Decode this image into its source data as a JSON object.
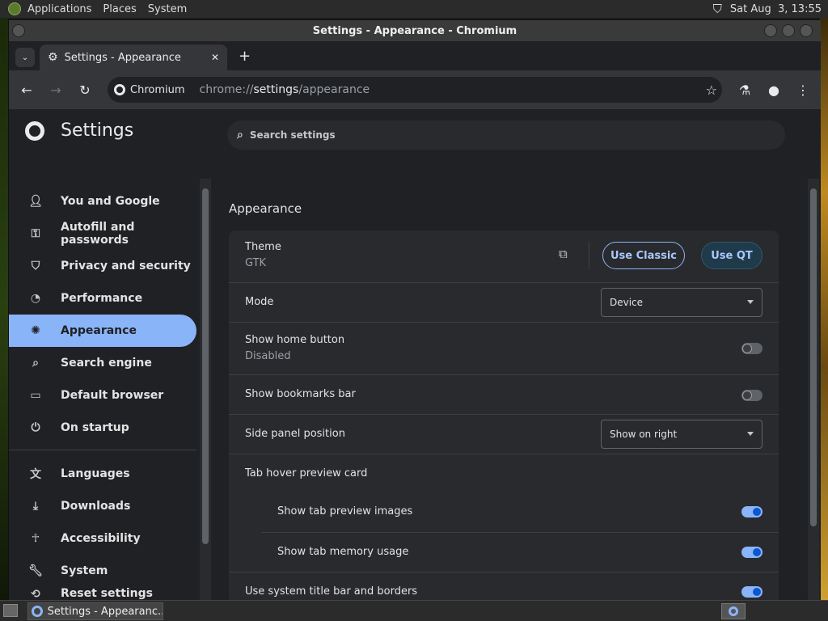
{
  "top_panel": {
    "menus": [
      "Applications",
      "Places",
      "System"
    ],
    "clock": "Sat Aug  3, 13:55"
  },
  "window": {
    "title": "Settings - Appearance - Chromium"
  },
  "tab": {
    "label": "Settings - Appearance"
  },
  "toolbar": {
    "site_label": "Chromium",
    "url_scheme": "chrome://",
    "url_host": "settings",
    "url_path": "/appearance"
  },
  "settings": {
    "title": "Settings",
    "search_placeholder": "Search settings",
    "nav": [
      {
        "label": "You and Google",
        "icon": "person-icon"
      },
      {
        "label": "Autofill and passwords",
        "icon": "key-icon"
      },
      {
        "label": "Privacy and security",
        "icon": "shield-icon"
      },
      {
        "label": "Performance",
        "icon": "speedometer-icon"
      },
      {
        "label": "Appearance",
        "icon": "palette-icon",
        "active": true
      },
      {
        "label": "Search engine",
        "icon": "search-icon"
      },
      {
        "label": "Default browser",
        "icon": "browser-icon"
      },
      {
        "label": "On startup",
        "icon": "power-icon"
      },
      {
        "label": "Languages",
        "icon": "translate-icon"
      },
      {
        "label": "Downloads",
        "icon": "download-icon"
      },
      {
        "label": "Accessibility",
        "icon": "accessibility-icon"
      },
      {
        "label": "System",
        "icon": "wrench-icon"
      },
      {
        "label": "Reset settings",
        "icon": "reset-icon"
      }
    ],
    "section_title": "Appearance",
    "theme": {
      "label": "Theme",
      "value": "GTK",
      "classic_button": "Use Classic",
      "qt_button": "Use QT"
    },
    "mode": {
      "label": "Mode",
      "selected": "Device"
    },
    "home_button": {
      "label": "Show home button",
      "sub": "Disabled",
      "enabled": false
    },
    "bookmarks_bar": {
      "label": "Show bookmarks bar",
      "enabled": false
    },
    "side_panel": {
      "label": "Side panel position",
      "selected": "Show on right"
    },
    "tab_hover": {
      "label": "Tab hover preview card"
    },
    "tab_preview_images": {
      "label": "Show tab preview images",
      "enabled": true
    },
    "tab_memory": {
      "label": "Show tab memory usage",
      "enabled": true
    },
    "system_title_bar": {
      "label": "Use system title bar and borders",
      "enabled": true
    }
  },
  "taskbar": {
    "item_label": "Settings - Appearanc..."
  },
  "colors": {
    "accent": "#8ab4f8",
    "toggle_on": "#0b57d0",
    "surface": "#292a2d",
    "background": "#202124"
  }
}
